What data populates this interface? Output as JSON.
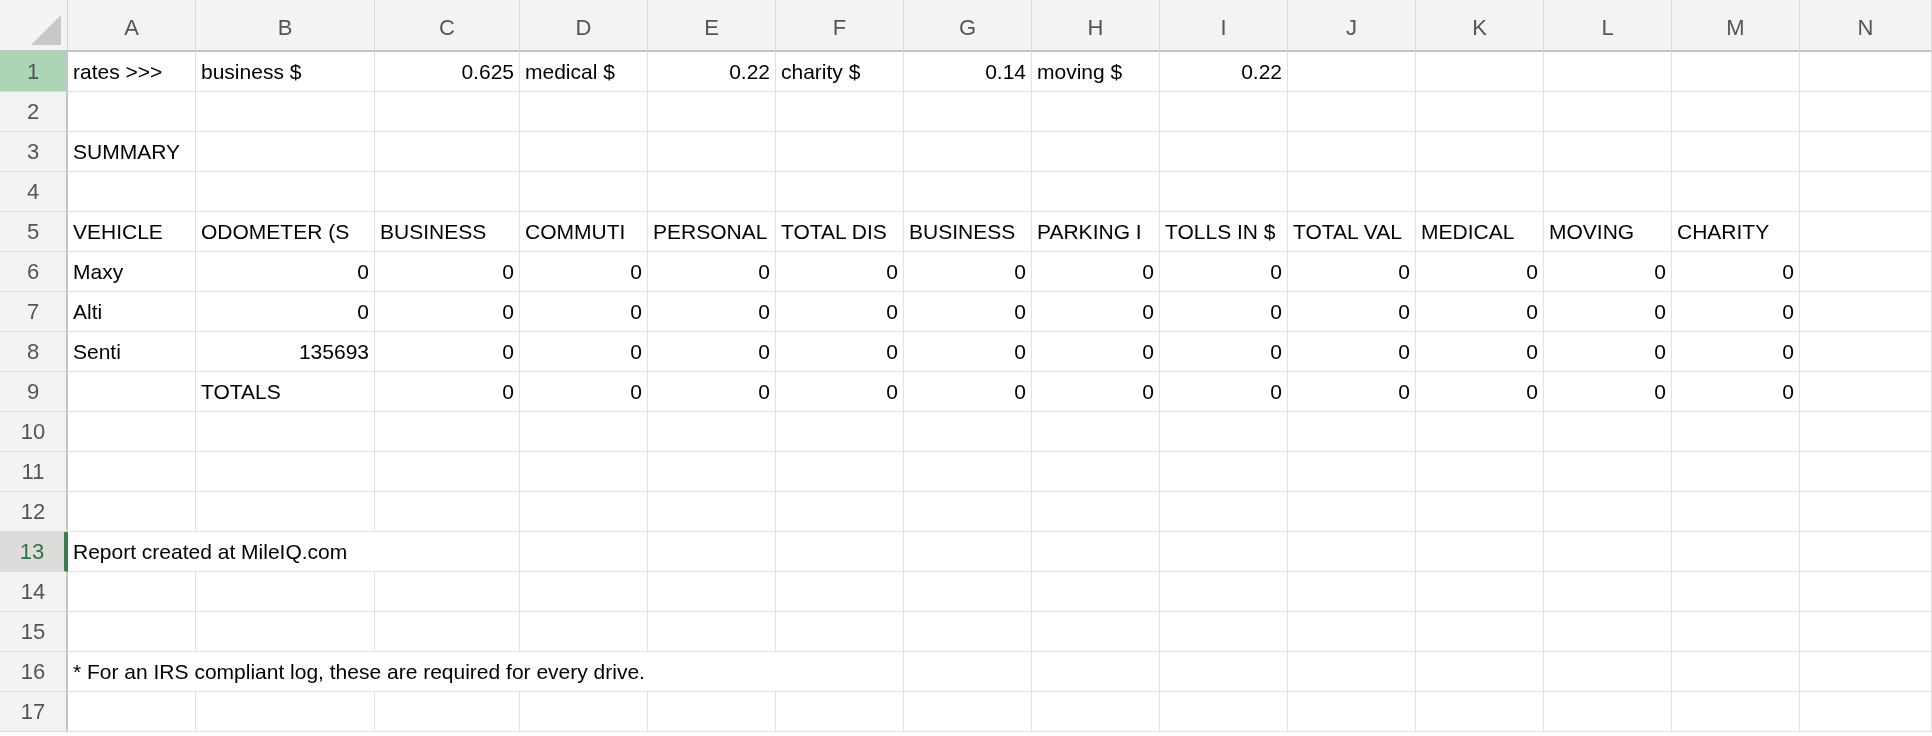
{
  "columns": [
    "A",
    "B",
    "C",
    "D",
    "E",
    "F",
    "G",
    "H",
    "I",
    "J",
    "K",
    "L",
    "M",
    "N"
  ],
  "rows": [
    {
      "header": "1",
      "selected": true,
      "active": false,
      "cells": [
        {
          "kind": "text",
          "text": "rates >>>"
        },
        {
          "kind": "text",
          "text": "business $"
        },
        {
          "kind": "number",
          "text": "0.625"
        },
        {
          "kind": "text",
          "text": "medical $"
        },
        {
          "kind": "number",
          "text": "0.22"
        },
        {
          "kind": "text",
          "text": "charity $"
        },
        {
          "kind": "number",
          "text": "0.14"
        },
        {
          "kind": "text",
          "text": "moving $"
        },
        {
          "kind": "number",
          "text": "0.22"
        }
      ]
    },
    {
      "header": "2",
      "selected": false,
      "active": false,
      "cells": []
    },
    {
      "header": "3",
      "selected": false,
      "active": false,
      "cells": [
        {
          "kind": "text",
          "text": "SUMMARY"
        }
      ]
    },
    {
      "header": "4",
      "selected": false,
      "active": false,
      "cells": []
    },
    {
      "header": "5",
      "selected": false,
      "active": false,
      "cells": [
        {
          "kind": "text",
          "text": "VEHICLE"
        },
        {
          "kind": "text",
          "text": "ODOMETER (S"
        },
        {
          "kind": "text",
          "text": "BUSINESS"
        },
        {
          "kind": "text",
          "text": "COMMUTI"
        },
        {
          "kind": "text",
          "text": "PERSONAL"
        },
        {
          "kind": "text",
          "text": "TOTAL DIS"
        },
        {
          "kind": "text",
          "text": "BUSINESS"
        },
        {
          "kind": "text",
          "text": "PARKING I"
        },
        {
          "kind": "text",
          "text": "TOLLS IN $"
        },
        {
          "kind": "text",
          "text": "TOTAL VAL"
        },
        {
          "kind": "text",
          "text": "MEDICAL"
        },
        {
          "kind": "text",
          "text": "MOVING"
        },
        {
          "kind": "text",
          "text": "CHARITY"
        }
      ]
    },
    {
      "header": "6",
      "selected": false,
      "active": false,
      "cells": [
        {
          "kind": "text",
          "text": "Maxy"
        },
        {
          "kind": "number",
          "text": "0"
        },
        {
          "kind": "number",
          "text": "0"
        },
        {
          "kind": "number",
          "text": "0"
        },
        {
          "kind": "number",
          "text": "0"
        },
        {
          "kind": "number",
          "text": "0"
        },
        {
          "kind": "number",
          "text": "0"
        },
        {
          "kind": "number",
          "text": "0"
        },
        {
          "kind": "number",
          "text": "0"
        },
        {
          "kind": "number",
          "text": "0"
        },
        {
          "kind": "number",
          "text": "0"
        },
        {
          "kind": "number",
          "text": "0"
        },
        {
          "kind": "number",
          "text": "0"
        }
      ]
    },
    {
      "header": "7",
      "selected": false,
      "active": false,
      "cells": [
        {
          "kind": "text",
          "text": "Alti"
        },
        {
          "kind": "number",
          "text": "0"
        },
        {
          "kind": "number",
          "text": "0"
        },
        {
          "kind": "number",
          "text": "0"
        },
        {
          "kind": "number",
          "text": "0"
        },
        {
          "kind": "number",
          "text": "0"
        },
        {
          "kind": "number",
          "text": "0"
        },
        {
          "kind": "number",
          "text": "0"
        },
        {
          "kind": "number",
          "text": "0"
        },
        {
          "kind": "number",
          "text": "0"
        },
        {
          "kind": "number",
          "text": "0"
        },
        {
          "kind": "number",
          "text": "0"
        },
        {
          "kind": "number",
          "text": "0"
        }
      ]
    },
    {
      "header": "8",
      "selected": false,
      "active": false,
      "cells": [
        {
          "kind": "text",
          "text": "Senti"
        },
        {
          "kind": "number",
          "text": "135693"
        },
        {
          "kind": "number",
          "text": "0"
        },
        {
          "kind": "number",
          "text": "0"
        },
        {
          "kind": "number",
          "text": "0"
        },
        {
          "kind": "number",
          "text": "0"
        },
        {
          "kind": "number",
          "text": "0"
        },
        {
          "kind": "number",
          "text": "0"
        },
        {
          "kind": "number",
          "text": "0"
        },
        {
          "kind": "number",
          "text": "0"
        },
        {
          "kind": "number",
          "text": "0"
        },
        {
          "kind": "number",
          "text": "0"
        },
        {
          "kind": "number",
          "text": "0"
        }
      ]
    },
    {
      "header": "9",
      "selected": false,
      "active": false,
      "cells": [
        {
          "kind": "blank"
        },
        {
          "kind": "text",
          "text": "TOTALS"
        },
        {
          "kind": "number",
          "text": "0"
        },
        {
          "kind": "number",
          "text": "0"
        },
        {
          "kind": "number",
          "text": "0"
        },
        {
          "kind": "number",
          "text": "0"
        },
        {
          "kind": "number",
          "text": "0"
        },
        {
          "kind": "number",
          "text": "0"
        },
        {
          "kind": "number",
          "text": "0"
        },
        {
          "kind": "number",
          "text": "0"
        },
        {
          "kind": "number",
          "text": "0"
        },
        {
          "kind": "number",
          "text": "0"
        },
        {
          "kind": "number",
          "text": "0"
        }
      ]
    },
    {
      "header": "10",
      "selected": false,
      "active": false,
      "cells": []
    },
    {
      "header": "11",
      "selected": false,
      "active": false,
      "cells": []
    },
    {
      "header": "12",
      "selected": false,
      "active": false,
      "cells": []
    },
    {
      "header": "13",
      "selected": false,
      "active": true,
      "cells": [
        {
          "kind": "text",
          "text": "Report created at MileIQ.com"
        }
      ]
    },
    {
      "header": "14",
      "selected": false,
      "active": false,
      "cells": []
    },
    {
      "header": "15",
      "selected": false,
      "active": false,
      "cells": []
    },
    {
      "header": "16",
      "selected": false,
      "active": false,
      "cells": [
        {
          "kind": "text",
          "text": "* For an IRS compliant log, these are required for every drive."
        }
      ]
    },
    {
      "header": "17",
      "selected": false,
      "active": false,
      "cells": []
    }
  ]
}
